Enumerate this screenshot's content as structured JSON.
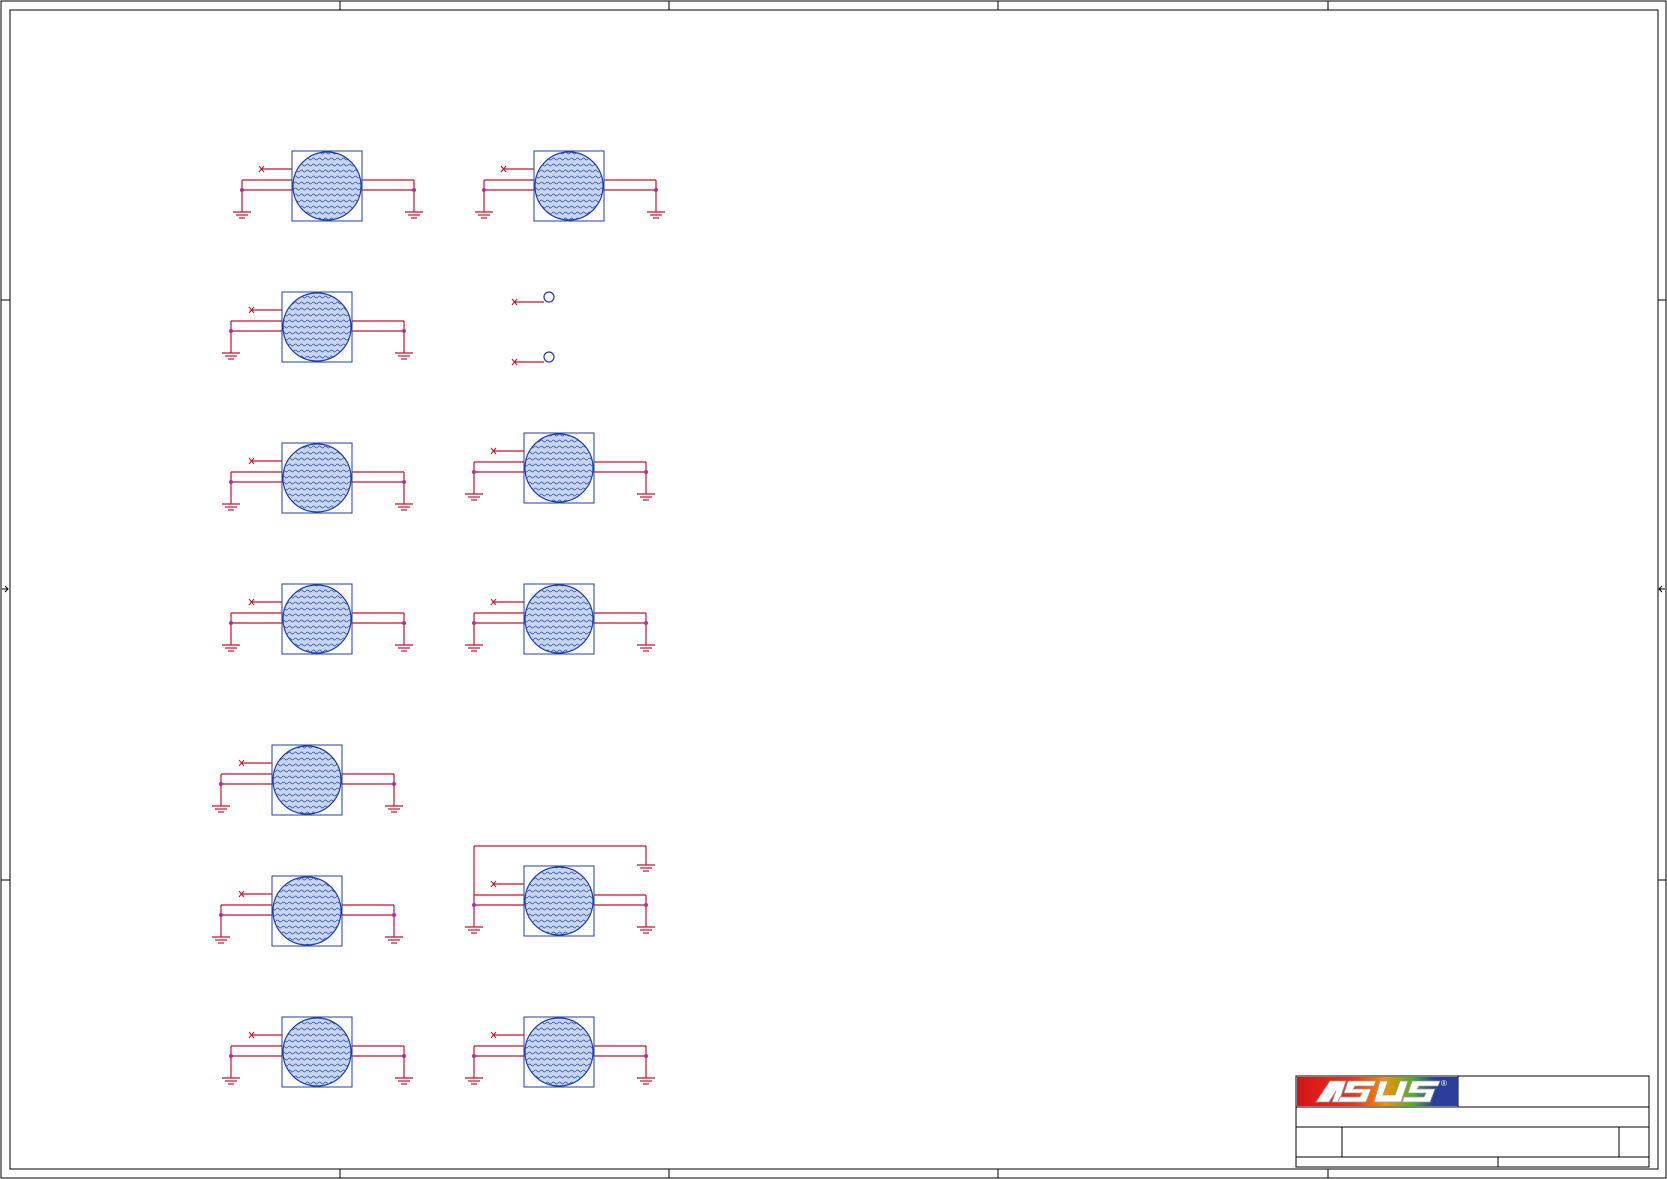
{
  "sheet": {
    "frame_color": "#000000",
    "wire_color": "#c8102e",
    "symbol_color": "#1f3fa8",
    "junction_color": "#b0309a"
  },
  "title_block": {
    "logo_text": "ASUS",
    "logo_mark": "®",
    "logo_colors": {
      "red": "#d7141a",
      "orange": "#f39200",
      "green": "#4caf2a",
      "blue": "#2b3f9a"
    }
  },
  "components": {
    "mounting_holes": [
      {
        "id": "hole-1"
      },
      {
        "id": "hole-2"
      },
      {
        "id": "hole-3"
      },
      {
        "id": "hole-4"
      },
      {
        "id": "hole-5"
      },
      {
        "id": "hole-6"
      },
      {
        "id": "hole-7"
      },
      {
        "id": "hole-8"
      },
      {
        "id": "hole-9"
      },
      {
        "id": "hole-10"
      },
      {
        "id": "hole-11"
      },
      {
        "id": "hole-12"
      },
      {
        "id": "hole-13"
      }
    ],
    "test_points": [
      {
        "id": "tp-1"
      },
      {
        "id": "tp-2"
      }
    ]
  }
}
